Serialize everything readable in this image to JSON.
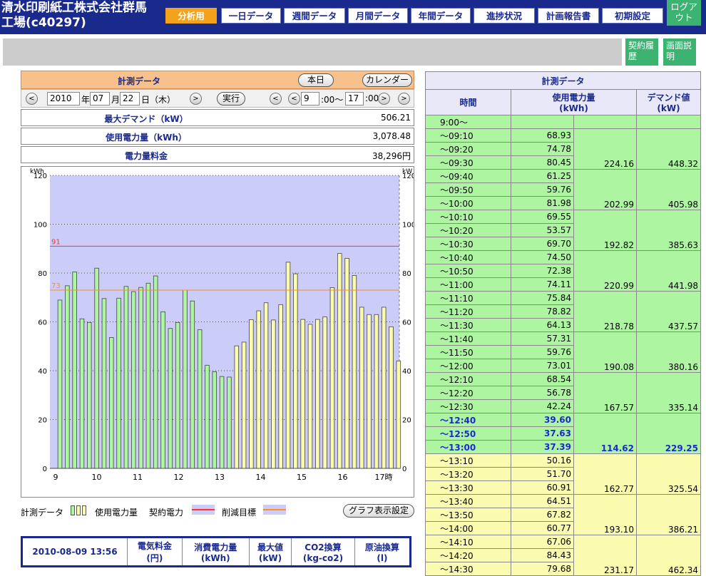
{
  "header": {
    "company": "清水印刷紙工株式会社群馬工場(c40297)",
    "nav": [
      "分析用",
      "一日データ",
      "週間データ",
      "月間データ",
      "年間データ",
      "進捗状況",
      "計画報告書",
      "初期設定"
    ],
    "logout": "ログアウト"
  },
  "side_buttons": {
    "contract_history": "契約履歴",
    "screen_help": "画面説明"
  },
  "panel": {
    "title": "計測データ",
    "today_btn": "本日",
    "calendar_btn": "カレンダー",
    "year": "2010",
    "year_unit": "年",
    "month": "07",
    "month_unit": "月",
    "day": "22",
    "day_unit": "日（木）",
    "run_btn": "実行",
    "time_from": "9",
    "time_mid": ":00〜",
    "time_to": "17",
    "time_end": ":00",
    "prev": "<",
    "next": ">"
  },
  "summary": [
    {
      "label": "最大デマンド（kW）",
      "value": "506.21"
    },
    {
      "label": "使用電力量（kWh）",
      "value": "3,078.48"
    },
    {
      "label": "電力量料金",
      "value": "38,296円"
    }
  ],
  "chart_data": {
    "type": "bar",
    "ylabel_left": "kWh",
    "ylabel_right": "kW",
    "ylim": [
      0,
      120
    ],
    "yticks": [
      0,
      20,
      40,
      60,
      80,
      100,
      120
    ],
    "xticks": [
      "9",
      "10",
      "11",
      "12",
      "13",
      "14",
      "15",
      "16",
      "17時"
    ],
    "contract_line": {
      "value": 91,
      "label": "91",
      "color": "#ff3030"
    },
    "target_line": {
      "value": 73,
      "label": "73",
      "color": "#ff8c28"
    },
    "values": [
      68.93,
      74.78,
      80.45,
      61.25,
      59.76,
      81.98,
      69.55,
      53.57,
      69.7,
      74.5,
      72.38,
      74.11,
      75.84,
      78.82,
      64.13,
      57.31,
      59.76,
      73.01,
      68.54,
      56.78,
      42.24,
      39.6,
      37.63,
      37.39,
      50.16,
      51.7,
      60.91,
      64.51,
      67.82,
      60.77,
      67.06,
      84.43,
      79.68,
      61.0,
      59.0,
      61.0,
      62.0,
      74.0,
      88.0,
      86.0,
      79.0,
      66.0,
      63.0,
      63.0,
      66.0,
      58.0,
      44.0
    ],
    "colors": {
      "green": "#aef5a2",
      "yellow": "#fbfbb0"
    },
    "green_count": 24
  },
  "legend": {
    "measure": "計測データ",
    "usage": "使用電力量",
    "contract": "契約電力",
    "target": "削減目標",
    "settings_btn": "グラフ表示設定"
  },
  "stats": {
    "datetime": "2010-08-09 13:56",
    "headers": [
      "電気料金\n(円)",
      "消費電力量\n(kWh)",
      "最大値\n(kW)",
      "CO2換算\n(kg-co2)",
      "原油換算\n(l)"
    ]
  },
  "table": {
    "title": "計測データ",
    "col_time": "時間",
    "col_usage": "使用電力量\n(kWh)",
    "col_demand": "デマンド値\n(kW)",
    "start": "9:00〜",
    "rows": [
      [
        "〜09:10",
        "68.93"
      ],
      [
        "〜09:20",
        "74.78"
      ],
      [
        "〜09:30",
        "80.45"
      ],
      [
        "〜09:40",
        "61.25"
      ],
      [
        "〜09:50",
        "59.76"
      ],
      [
        "〜10:00",
        "81.98"
      ],
      [
        "〜10:10",
        "69.55"
      ],
      [
        "〜10:20",
        "53.57"
      ],
      [
        "〜10:30",
        "69.70"
      ],
      [
        "〜10:40",
        "74.50"
      ],
      [
        "〜10:50",
        "72.38"
      ],
      [
        "〜11:00",
        "74.11"
      ],
      [
        "〜11:10",
        "75.84"
      ],
      [
        "〜11:20",
        "78.82"
      ],
      [
        "〜11:30",
        "64.13"
      ],
      [
        "〜11:40",
        "57.31"
      ],
      [
        "〜11:50",
        "59.76"
      ],
      [
        "〜12:00",
        "73.01"
      ],
      [
        "〜12:10",
        "68.54"
      ],
      [
        "〜12:20",
        "56.78"
      ],
      [
        "〜12:30",
        "42.24"
      ],
      [
        "〜12:40",
        "39.60"
      ],
      [
        "〜12:50",
        "37.63"
      ],
      [
        "〜13:00",
        "37.39"
      ],
      [
        "〜13:10",
        "50.16"
      ],
      [
        "〜13:20",
        "51.70"
      ],
      [
        "〜13:30",
        "60.91"
      ],
      [
        "〜13:40",
        "64.51"
      ],
      [
        "〜13:50",
        "67.82"
      ],
      [
        "〜14:00",
        "60.77"
      ],
      [
        "〜14:10",
        "67.06"
      ],
      [
        "〜14:20",
        "84.43"
      ],
      [
        "〜14:30",
        "79.68"
      ]
    ],
    "group_totals": [
      [
        "224.16",
        "448.32"
      ],
      [
        "202.99",
        "405.98"
      ],
      [
        "192.82",
        "385.63"
      ],
      [
        "220.99",
        "441.98"
      ],
      [
        "218.78",
        "437.57"
      ],
      [
        "190.08",
        "380.16"
      ],
      [
        "167.57",
        "335.14"
      ],
      [
        "114.62",
        "229.25"
      ],
      [
        "162.77",
        "325.54"
      ],
      [
        "193.10",
        "386.21"
      ],
      [
        "231.17",
        "462.34"
      ]
    ],
    "green_groups": 8,
    "highlight_group": 7
  }
}
